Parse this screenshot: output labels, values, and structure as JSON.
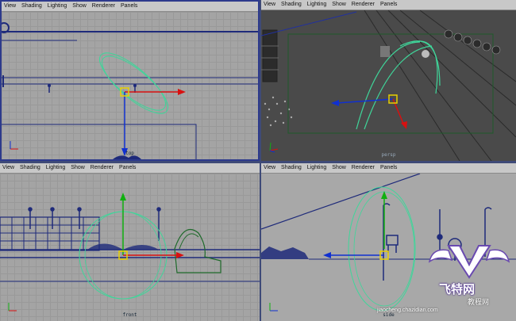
{
  "menu": [
    "View",
    "Shading",
    "Lighting",
    "Show",
    "Renderer",
    "Panels"
  ],
  "viewports": {
    "top": {
      "camera": "top"
    },
    "persp": {
      "camera": "persp"
    },
    "front": {
      "camera": "front"
    },
    "side": {
      "camera": "side"
    }
  },
  "watermark": {
    "brand": "飞特网",
    "site": "jiaocheng.chazidian.com",
    "subtitle": "教程网"
  },
  "colors": {
    "nurbs": "#3fd69a",
    "mesh": "#1e2a7a",
    "manip_x": "#d81010",
    "manip_y": "#10b010",
    "manip_z": "#1030d0",
    "pivot": "#e8d000"
  }
}
